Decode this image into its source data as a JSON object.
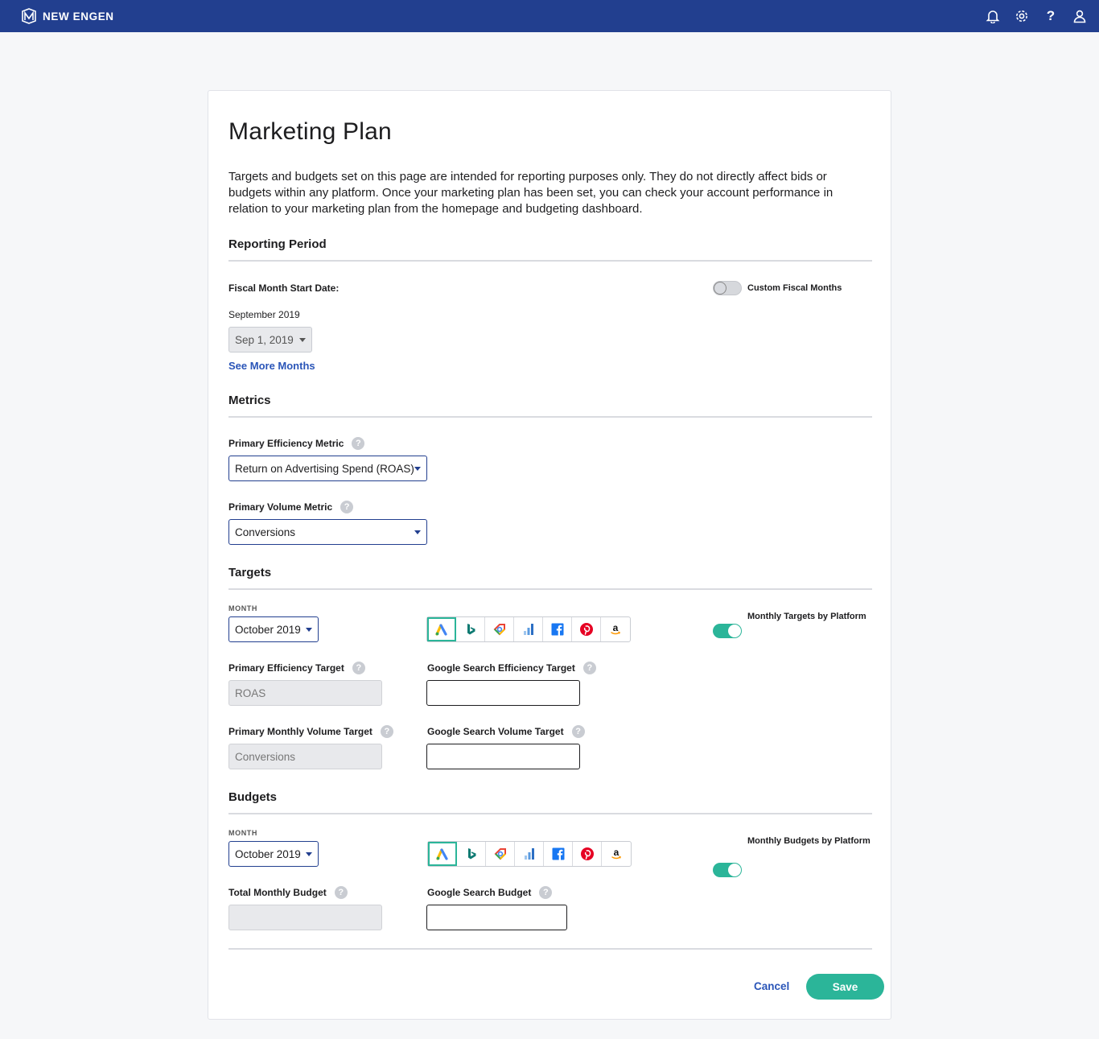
{
  "app": {
    "brand_name": "NEW ENGEN"
  },
  "header_icons": [
    "bell-icon",
    "gear-icon",
    "help-icon",
    "user-icon"
  ],
  "header": {
    "help_glyph": "?"
  },
  "page": {
    "title": "Marketing Plan",
    "intro": "Targets and budgets set on this page are intended for reporting purposes only. They do not directly affect bids or budgets within any platform. Once your marketing plan has been set, you can check your account performance in relation to your marketing plan from the homepage and budgeting dashboard."
  },
  "reporting_period": {
    "title": "Reporting Period",
    "fiscal_label": "Fiscal Month Start Date:",
    "month_label": "September 2019",
    "date_value": "Sep 1, 2019",
    "see_more": "See More Months",
    "custom_toggle_label": "Custom Fiscal Months",
    "custom_toggle_on": false
  },
  "metrics": {
    "title": "Metrics",
    "efficiency_label": "Primary Efficiency Metric",
    "efficiency_value": "Return on Advertising Spend (ROAS)",
    "volume_label": "Primary Volume Metric",
    "volume_value": "Conversions",
    "help_glyph": "?"
  },
  "targets": {
    "title": "Targets",
    "month_label": "MONTH",
    "month_value": "October 2019",
    "toggle_label": "Monthly Targets by Platform",
    "toggle_on": true,
    "primary_efficiency_label": "Primary Efficiency Target",
    "primary_efficiency_value": "ROAS",
    "platform_efficiency_label": "Google Search Efficiency Target",
    "primary_volume_label": "Primary Monthly Volume Target",
    "primary_volume_value": "Conversions",
    "platform_volume_label": "Google Search Volume Target"
  },
  "budgets": {
    "title": "Budgets",
    "month_label": "MONTH",
    "month_value": "October 2019",
    "toggle_label": "Monthly Budgets by Platform",
    "toggle_on": true,
    "total_label": "Total Monthly Budget",
    "platform_budget_label": "Google Search Budget"
  },
  "platforms": [
    {
      "name": "google-ads-icon",
      "active": true
    },
    {
      "name": "bing-icon",
      "active": false
    },
    {
      "name": "google-shopping-icon",
      "active": false
    },
    {
      "name": "analytics-bars-icon",
      "active": false
    },
    {
      "name": "facebook-icon",
      "active": false
    },
    {
      "name": "pinterest-icon",
      "active": false
    },
    {
      "name": "amazon-icon",
      "active": false
    }
  ],
  "actions": {
    "cancel": "Cancel",
    "save": "Save"
  },
  "colors": {
    "header": "#223f8f",
    "accent": "#2bb599",
    "link": "#2a55b8"
  }
}
